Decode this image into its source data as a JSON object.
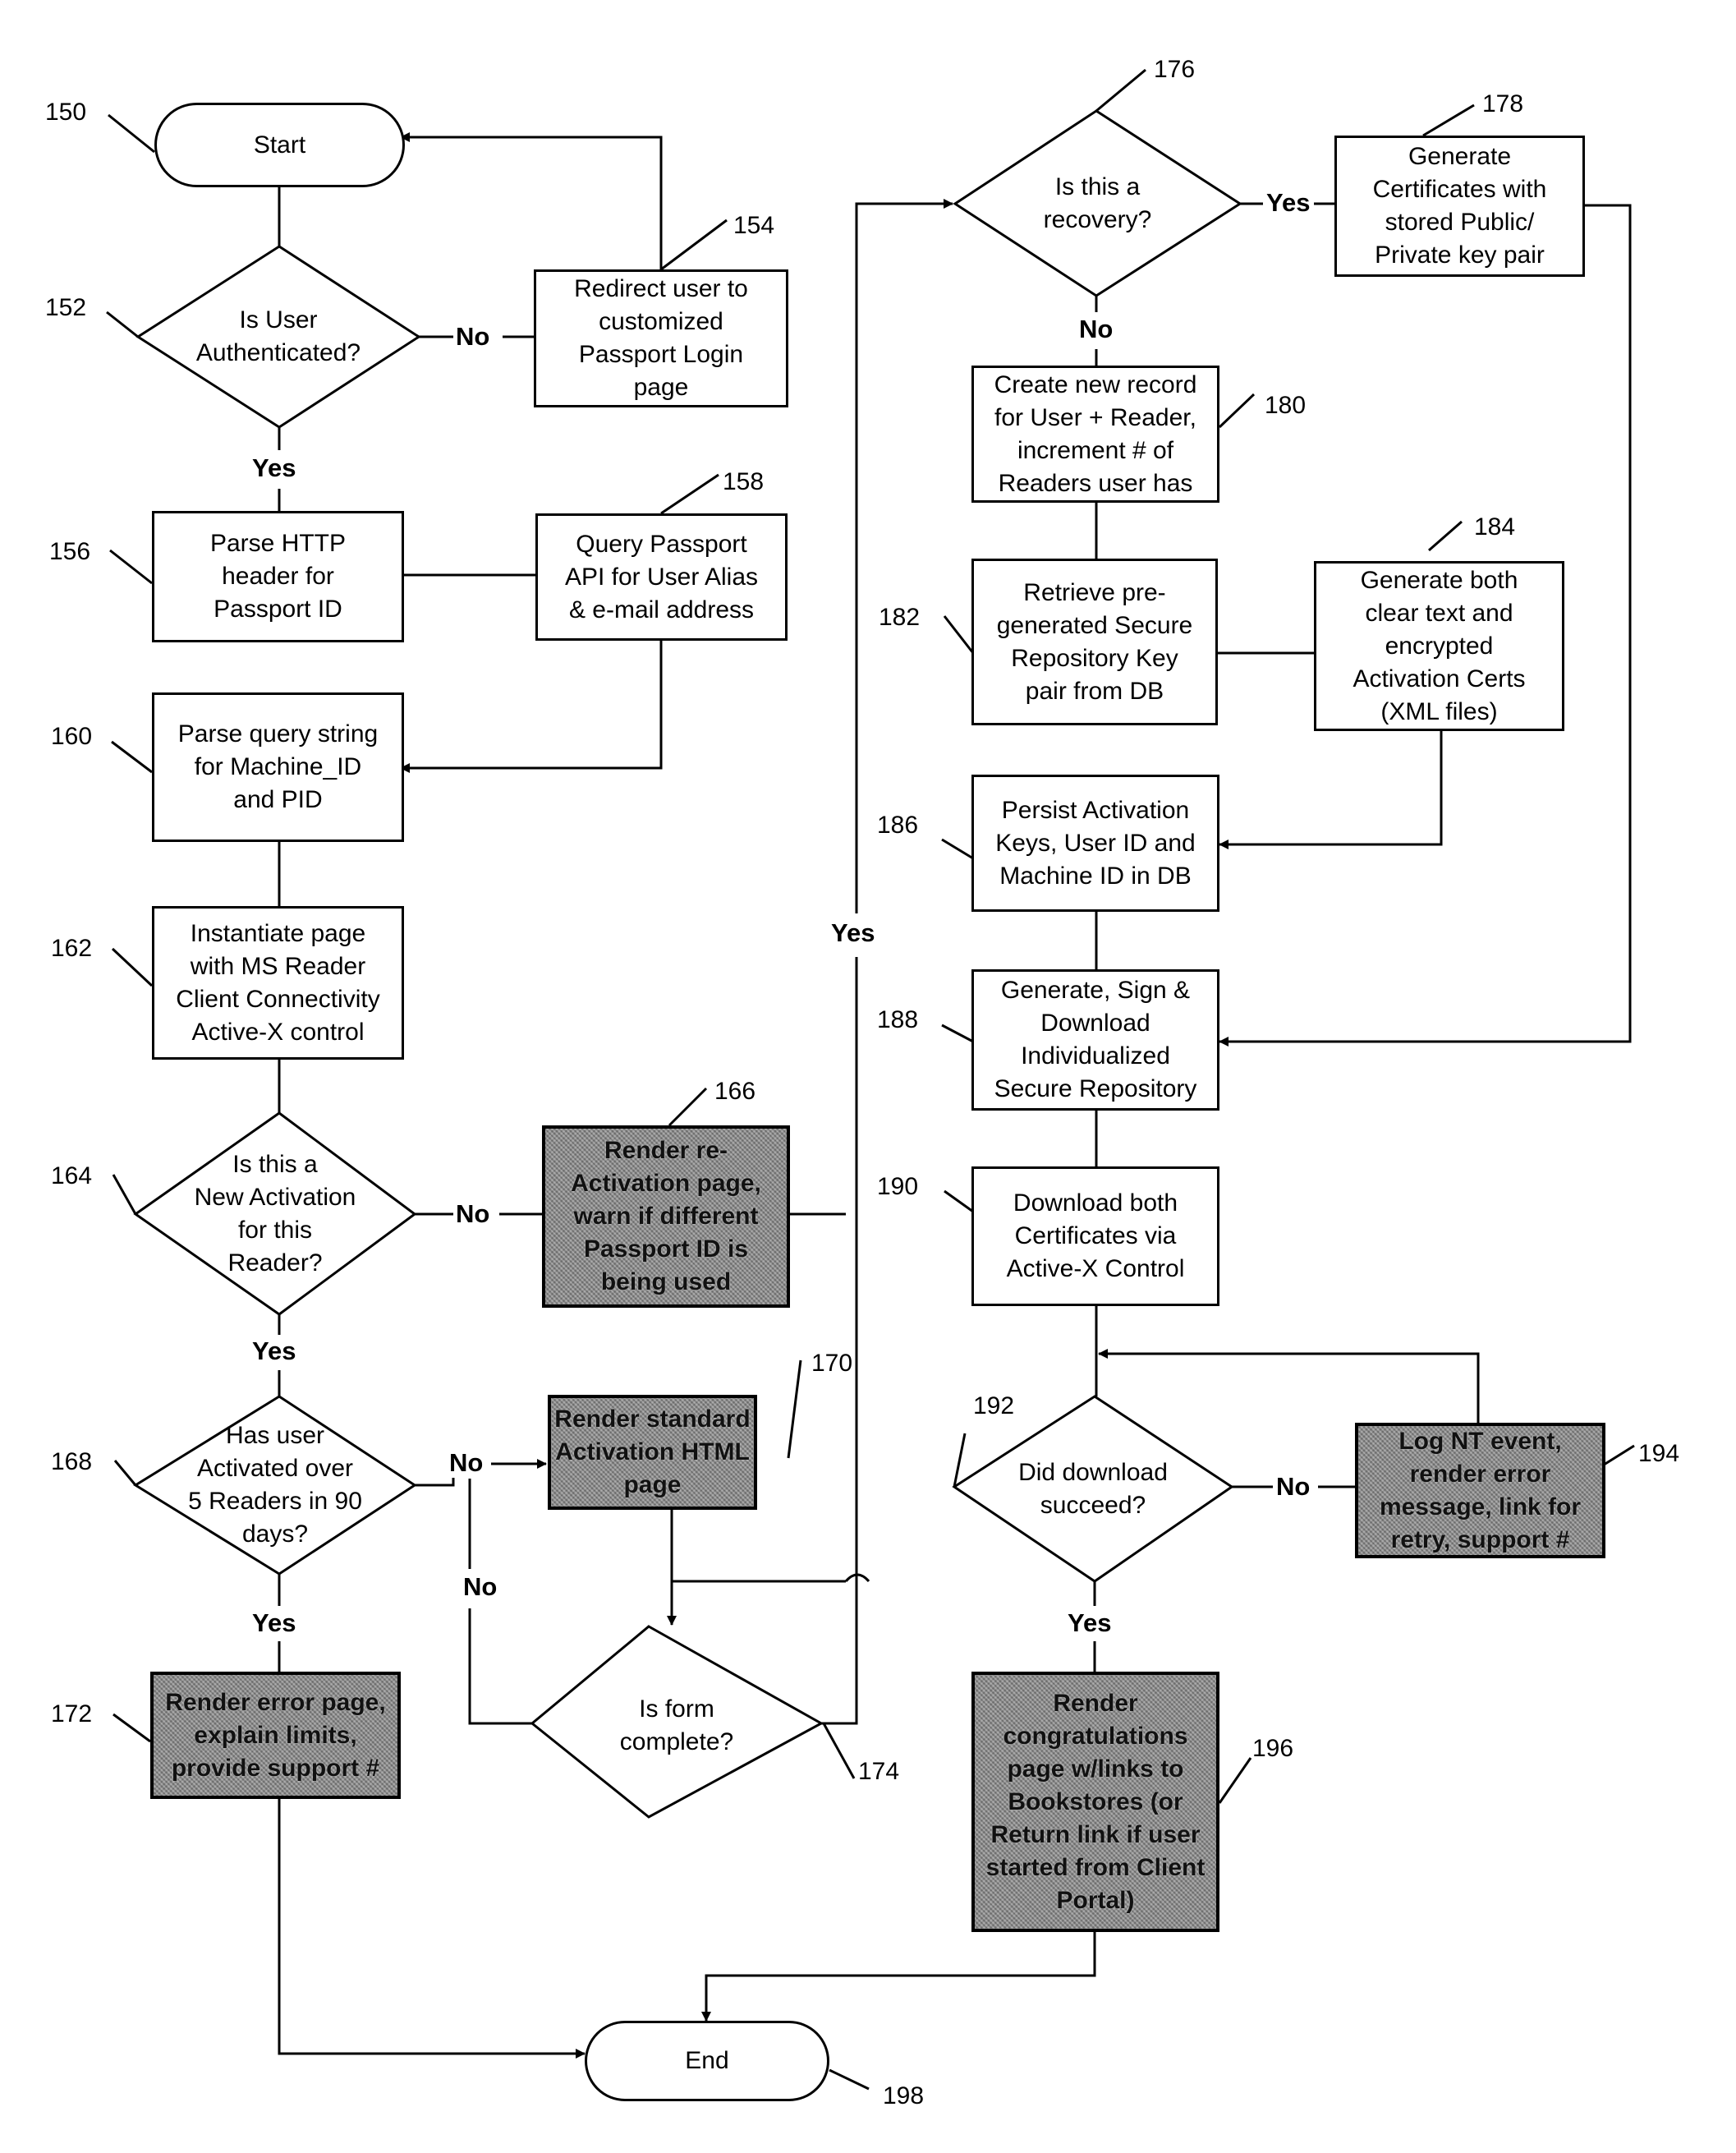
{
  "diagram": {
    "type": "flowchart",
    "nodes": {
      "n150": {
        "ref": "150",
        "text": "Start"
      },
      "n152": {
        "ref": "152",
        "text": "Is User\nAuthenticated?"
      },
      "n154": {
        "ref": "154",
        "text": "Redirect user to\ncustomized\nPassport Login\npage"
      },
      "n156": {
        "ref": "156",
        "text": "Parse HTTP\nheader for\nPassport ID"
      },
      "n158": {
        "ref": "158",
        "text": "Query Passport\nAPI for User Alias\n& e-mail address"
      },
      "n160": {
        "ref": "160",
        "text": "Parse query string\nfor Machine_ID\nand PID"
      },
      "n162": {
        "ref": "162",
        "text": "Instantiate page\nwith MS Reader\nClient Connectivity\nActive-X control"
      },
      "n164": {
        "ref": "164",
        "text": "Is this a\nNew Activation\nfor this\nReader?"
      },
      "n166": {
        "ref": "166",
        "text": "Render re-\nActivation page,\nwarn if different\nPassport ID is\nbeing used"
      },
      "n168": {
        "ref": "168",
        "text": "Has user\nActivated over\n5 Readers in 90\ndays?"
      },
      "n170": {
        "ref": "170",
        "text": "Render standard\nActivation HTML\npage"
      },
      "n172": {
        "ref": "172",
        "text": "Render error page,\nexplain limits,\nprovide support #"
      },
      "n174": {
        "ref": "174",
        "text": "Is form\ncomplete?"
      },
      "n176": {
        "ref": "176",
        "text": "Is this a\nrecovery?"
      },
      "n178": {
        "ref": "178",
        "text": "Generate\nCertificates with\nstored Public/\nPrivate key pair"
      },
      "n180": {
        "ref": "180",
        "text": "Create new record\nfor User + Reader,\nincrement # of\nReaders user has"
      },
      "n182": {
        "ref": "182",
        "text": "Retrieve pre-\ngenerated Secure\nRepository Key\npair from DB"
      },
      "n184": {
        "ref": "184",
        "text": "Generate both\nclear text and\nencrypted\nActivation Certs\n(XML files)"
      },
      "n186": {
        "ref": "186",
        "text": "Persist Activation\nKeys, User ID and\nMachine ID in DB"
      },
      "n188": {
        "ref": "188",
        "text": "Generate, Sign &\nDownload\nIndividualized\nSecure Repository"
      },
      "n190": {
        "ref": "190",
        "text": "Download both\nCertificates via\nActive-X Control"
      },
      "n192": {
        "ref": "192",
        "text": "Did download\nsucceed?"
      },
      "n194": {
        "ref": "194",
        "text": "Log NT event,\nrender error\nmessage, link for\nretry, support #"
      },
      "n196": {
        "ref": "196",
        "text": "Render\ncongratulations\npage w/links to\nBookstores (or\nReturn link if user\nstarted from Client\nPortal)"
      },
      "n198": {
        "ref": "198",
        "text": "End"
      }
    },
    "edge_labels": {
      "e152_no": "No",
      "e152_yes": "Yes",
      "e164_no": "No",
      "e164_yes": "Yes",
      "e168_no": "No",
      "e168_yes": "Yes",
      "e174_no": "No",
      "e174_yes": "Yes",
      "e176_yes": "Yes",
      "e176_no": "No",
      "e192_no": "No",
      "e192_yes": "Yes"
    }
  }
}
